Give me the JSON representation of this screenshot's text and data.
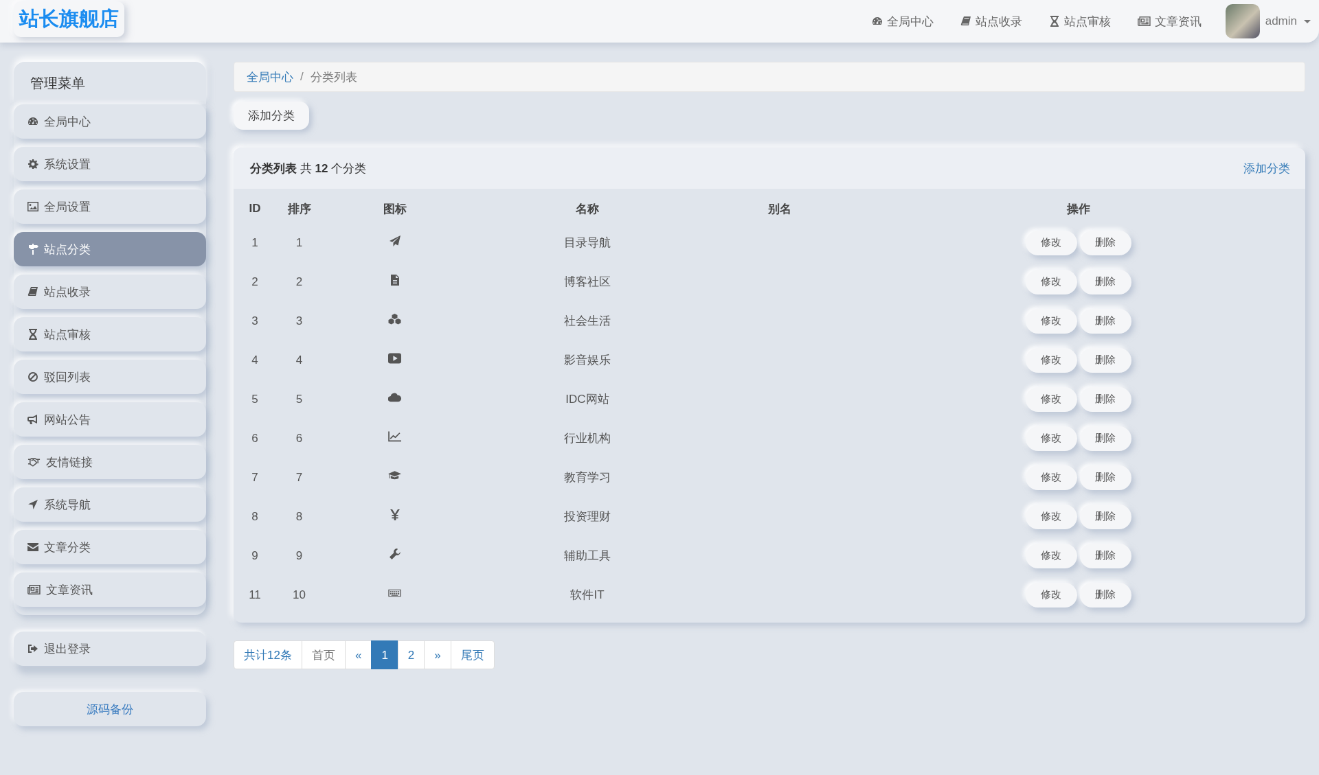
{
  "brand": "站长旗舰店",
  "top_nav": [
    {
      "label": "全局中心"
    },
    {
      "label": "站点收录"
    },
    {
      "label": "站点审核"
    },
    {
      "label": "文章资讯"
    }
  ],
  "user": {
    "name": "admin"
  },
  "sidebar": {
    "title": "管理菜单",
    "items": [
      {
        "label": "全局中心",
        "selected": false
      },
      {
        "label": "系统设置",
        "selected": false
      },
      {
        "label": "全局设置",
        "selected": false
      },
      {
        "label": "站点分类",
        "selected": true
      },
      {
        "label": "站点收录",
        "selected": false
      },
      {
        "label": "站点审核",
        "selected": false
      },
      {
        "label": "驳回列表",
        "selected": false
      },
      {
        "label": "网站公告",
        "selected": false
      },
      {
        "label": "友情链接",
        "selected": false
      },
      {
        "label": "系统导航",
        "selected": false
      },
      {
        "label": "文章分类",
        "selected": false
      },
      {
        "label": "文章资讯",
        "selected": false
      }
    ],
    "logout": "退出登录",
    "footer_link": "源码备份"
  },
  "breadcrumb": [
    {
      "label": "全局中心"
    },
    {
      "label": "分类列表"
    }
  ],
  "breadcrumb_separator": "/",
  "add_button": "添加分类",
  "panel": {
    "title": "**分类列表** 共 **12** 个分类",
    "action": "添加分类",
    "columns": [
      "ID",
      "排序",
      "图标",
      "名称",
      "别名",
      "操作"
    ],
    "rows": [
      {
        "id": "1",
        "order": "1",
        "name": "目录导航",
        "actions": [
          "修改",
          "删除"
        ]
      },
      {
        "id": "2",
        "order": "2",
        "name": "博客社区",
        "actions": [
          "修改",
          "删除"
        ]
      },
      {
        "id": "3",
        "order": "3",
        "name": "社会生活",
        "actions": [
          "修改",
          "删除"
        ]
      },
      {
        "id": "4",
        "order": "4",
        "name": "影音娱乐",
        "actions": [
          "修改",
          "删除"
        ]
      },
      {
        "id": "5",
        "order": "5",
        "name": "IDC网站",
        "actions": [
          "修改",
          "删除"
        ]
      },
      {
        "id": "6",
        "order": "6",
        "name": "行业机构",
        "actions": [
          "修改",
          "删除"
        ]
      },
      {
        "id": "7",
        "order": "7",
        "name": "教育学习",
        "actions": [
          "修改",
          "删除"
        ]
      },
      {
        "id": "8",
        "order": "8",
        "name": "投资理财",
        "actions": [
          "修改",
          "删除"
        ]
      },
      {
        "id": "9",
        "order": "9",
        "name": "辅助工具",
        "actions": [
          "修改",
          "删除"
        ]
      },
      {
        "id": "11",
        "order": "10",
        "name": "软件IT",
        "actions": [
          "修改",
          "删除"
        ]
      }
    ]
  },
  "pagination": [
    {
      "label": "共计12条",
      "selected": false
    },
    {
      "label": "首页",
      "selected": false
    },
    {
      "label": "«",
      "selected": false
    },
    {
      "label": "1",
      "selected": true
    },
    {
      "label": "2",
      "selected": false
    },
    {
      "label": "»",
      "selected": false
    },
    {
      "label": "尾页",
      "selected": false
    }
  ]
}
